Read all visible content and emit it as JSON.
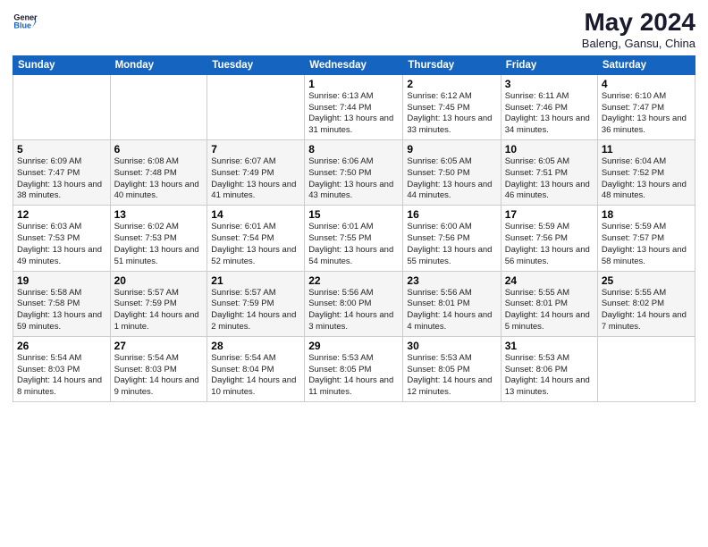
{
  "header": {
    "logo_general": "General",
    "logo_blue": "Blue",
    "title": "May 2024",
    "location": "Baleng, Gansu, China"
  },
  "weekdays": [
    "Sunday",
    "Monday",
    "Tuesday",
    "Wednesday",
    "Thursday",
    "Friday",
    "Saturday"
  ],
  "weeks": [
    [
      {
        "day": "",
        "info": ""
      },
      {
        "day": "",
        "info": ""
      },
      {
        "day": "",
        "info": ""
      },
      {
        "day": "1",
        "info": "Sunrise: 6:13 AM\nSunset: 7:44 PM\nDaylight: 13 hours\nand 31 minutes."
      },
      {
        "day": "2",
        "info": "Sunrise: 6:12 AM\nSunset: 7:45 PM\nDaylight: 13 hours\nand 33 minutes."
      },
      {
        "day": "3",
        "info": "Sunrise: 6:11 AM\nSunset: 7:46 PM\nDaylight: 13 hours\nand 34 minutes."
      },
      {
        "day": "4",
        "info": "Sunrise: 6:10 AM\nSunset: 7:47 PM\nDaylight: 13 hours\nand 36 minutes."
      }
    ],
    [
      {
        "day": "5",
        "info": "Sunrise: 6:09 AM\nSunset: 7:47 PM\nDaylight: 13 hours\nand 38 minutes."
      },
      {
        "day": "6",
        "info": "Sunrise: 6:08 AM\nSunset: 7:48 PM\nDaylight: 13 hours\nand 40 minutes."
      },
      {
        "day": "7",
        "info": "Sunrise: 6:07 AM\nSunset: 7:49 PM\nDaylight: 13 hours\nand 41 minutes."
      },
      {
        "day": "8",
        "info": "Sunrise: 6:06 AM\nSunset: 7:50 PM\nDaylight: 13 hours\nand 43 minutes."
      },
      {
        "day": "9",
        "info": "Sunrise: 6:05 AM\nSunset: 7:50 PM\nDaylight: 13 hours\nand 44 minutes."
      },
      {
        "day": "10",
        "info": "Sunrise: 6:05 AM\nSunset: 7:51 PM\nDaylight: 13 hours\nand 46 minutes."
      },
      {
        "day": "11",
        "info": "Sunrise: 6:04 AM\nSunset: 7:52 PM\nDaylight: 13 hours\nand 48 minutes."
      }
    ],
    [
      {
        "day": "12",
        "info": "Sunrise: 6:03 AM\nSunset: 7:53 PM\nDaylight: 13 hours\nand 49 minutes."
      },
      {
        "day": "13",
        "info": "Sunrise: 6:02 AM\nSunset: 7:53 PM\nDaylight: 13 hours\nand 51 minutes."
      },
      {
        "day": "14",
        "info": "Sunrise: 6:01 AM\nSunset: 7:54 PM\nDaylight: 13 hours\nand 52 minutes."
      },
      {
        "day": "15",
        "info": "Sunrise: 6:01 AM\nSunset: 7:55 PM\nDaylight: 13 hours\nand 54 minutes."
      },
      {
        "day": "16",
        "info": "Sunrise: 6:00 AM\nSunset: 7:56 PM\nDaylight: 13 hours\nand 55 minutes."
      },
      {
        "day": "17",
        "info": "Sunrise: 5:59 AM\nSunset: 7:56 PM\nDaylight: 13 hours\nand 56 minutes."
      },
      {
        "day": "18",
        "info": "Sunrise: 5:59 AM\nSunset: 7:57 PM\nDaylight: 13 hours\nand 58 minutes."
      }
    ],
    [
      {
        "day": "19",
        "info": "Sunrise: 5:58 AM\nSunset: 7:58 PM\nDaylight: 13 hours\nand 59 minutes."
      },
      {
        "day": "20",
        "info": "Sunrise: 5:57 AM\nSunset: 7:59 PM\nDaylight: 14 hours\nand 1 minute."
      },
      {
        "day": "21",
        "info": "Sunrise: 5:57 AM\nSunset: 7:59 PM\nDaylight: 14 hours\nand 2 minutes."
      },
      {
        "day": "22",
        "info": "Sunrise: 5:56 AM\nSunset: 8:00 PM\nDaylight: 14 hours\nand 3 minutes."
      },
      {
        "day": "23",
        "info": "Sunrise: 5:56 AM\nSunset: 8:01 PM\nDaylight: 14 hours\nand 4 minutes."
      },
      {
        "day": "24",
        "info": "Sunrise: 5:55 AM\nSunset: 8:01 PM\nDaylight: 14 hours\nand 5 minutes."
      },
      {
        "day": "25",
        "info": "Sunrise: 5:55 AM\nSunset: 8:02 PM\nDaylight: 14 hours\nand 7 minutes."
      }
    ],
    [
      {
        "day": "26",
        "info": "Sunrise: 5:54 AM\nSunset: 8:03 PM\nDaylight: 14 hours\nand 8 minutes."
      },
      {
        "day": "27",
        "info": "Sunrise: 5:54 AM\nSunset: 8:03 PM\nDaylight: 14 hours\nand 9 minutes."
      },
      {
        "day": "28",
        "info": "Sunrise: 5:54 AM\nSunset: 8:04 PM\nDaylight: 14 hours\nand 10 minutes."
      },
      {
        "day": "29",
        "info": "Sunrise: 5:53 AM\nSunset: 8:05 PM\nDaylight: 14 hours\nand 11 minutes."
      },
      {
        "day": "30",
        "info": "Sunrise: 5:53 AM\nSunset: 8:05 PM\nDaylight: 14 hours\nand 12 minutes."
      },
      {
        "day": "31",
        "info": "Sunrise: 5:53 AM\nSunset: 8:06 PM\nDaylight: 14 hours\nand 13 minutes."
      },
      {
        "day": "",
        "info": ""
      }
    ]
  ]
}
